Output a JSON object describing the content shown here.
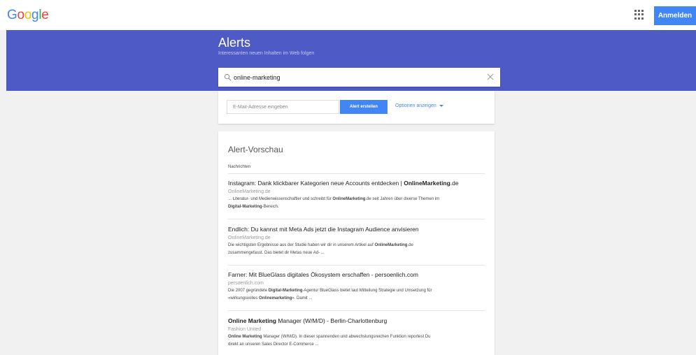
{
  "logo": {
    "letters": [
      "G",
      "o",
      "o",
      "g",
      "l",
      "e"
    ],
    "colors": [
      "#4285f4",
      "#ea4335",
      "#fbbc05",
      "#4285f4",
      "#34a853",
      "#ea4335"
    ]
  },
  "topbar": {
    "apps_icon": "apps-grid-icon",
    "signin_label": "Anmelden"
  },
  "hero": {
    "title": "Alerts",
    "subtitle": "Interessanten neuen Inhalten im Web folgen",
    "search_value": "online-marketing",
    "search_icon": "search-icon",
    "clear_icon": "close-icon",
    "color": "#4e5ac6"
  },
  "form": {
    "email_placeholder": "E-Mail-Adresse eingeben",
    "create_label": "Alert erstellen",
    "options_label": "Optionen anzeigen",
    "options_icon": "caret-down-icon"
  },
  "preview": {
    "title": "Alert-Vorschau",
    "section": "Nachrichten",
    "results": [
      {
        "title": [
          [
            "Instagram: Dank klickbarer Kategorien neue Accounts entdecken | ",
            false
          ],
          [
            "OnlineMarketing",
            true
          ],
          [
            ".de",
            false
          ]
        ],
        "source": "OnlineMarketing.de",
        "snippet1": [
          [
            "... Literatur- und Medienwissenschaftler und schreibt für ",
            false
          ],
          [
            "OnlineMarketing",
            true
          ],
          [
            ".de seit Jahren über diverse Themen im",
            false
          ]
        ],
        "snippet2": [
          [
            "Digital-Marketing",
            true
          ],
          [
            "-Bereich.",
            false
          ]
        ]
      },
      {
        "title": [
          [
            "Endlich: Du kannst mit Meta Ads jetzt die Instagram Audience anvisieren",
            false
          ]
        ],
        "source": "OnlineMarketing.de",
        "snippet1": [
          [
            "Die wichtigsten Ergebnisse aus der Studie haben wir dir in unserem Artikel auf ",
            false
          ],
          [
            "OnlineMarketing",
            true
          ],
          [
            ".de",
            false
          ]
        ],
        "snippet2": [
          [
            "zusammengefasst. Das bietet dir Metas neue Ad- ...",
            false
          ]
        ]
      },
      {
        "title": [
          [
            "Farner: Mit BlueGlass digitales Ökosystem erschaffen - persoenlich.com",
            false
          ]
        ],
        "source": "persoenlich.com",
        "snippet1": [
          [
            "Die 2007 gegründete ",
            false
          ],
          [
            "Digital-Marketing",
            true
          ],
          [
            "-Agentur BlueGlass bietet laut Mitteilung Strategie und Umsetzung für",
            false
          ]
        ],
        "snippet2": [
          [
            "«wirkungsvolles ",
            false
          ],
          [
            "Onlinemarketing",
            true
          ],
          [
            "». Damit ...",
            false
          ]
        ]
      },
      {
        "title": [
          [
            "Online Marketing",
            true
          ],
          [
            " Manager (W/M/D) - Berlin-Charlottenburg",
            false
          ]
        ],
        "source": "Fashion United",
        "snippet1": [
          [
            "Online Marketing",
            true
          ],
          [
            " Manager (W/M/D). In dieser spannenden und abwechslungsreichen Funktion reportest Du",
            false
          ]
        ],
        "snippet2": [
          [
            "direkt an unseren Sales Director E-Commerce ...",
            false
          ]
        ]
      }
    ]
  }
}
